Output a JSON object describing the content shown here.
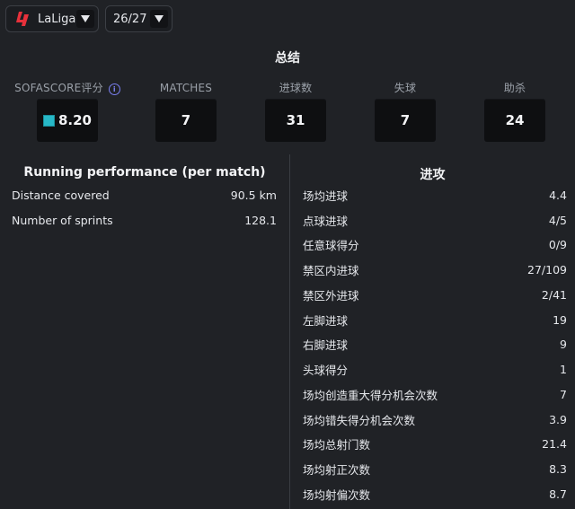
{
  "league_selector": {
    "label": "LaLiga",
    "logo_color": "#e8313b"
  },
  "season_selector": {
    "label": "26/27"
  },
  "summary": {
    "title": "总结",
    "rating": {
      "label": "SOFASCORE评分",
      "value": "8.20",
      "color": "#27b8c7"
    },
    "matches": {
      "label": "MATCHES",
      "value": "7"
    },
    "goals": {
      "label": "进球数",
      "value": "31"
    },
    "conceded": {
      "label": "失球",
      "value": "7"
    },
    "assists": {
      "label": "助杀",
      "value": "24"
    }
  },
  "running": {
    "title": "Running performance (per match)",
    "rows": [
      {
        "label": "Distance covered",
        "value": "90.5 km"
      },
      {
        "label": "Number of sprints",
        "value": "128.1"
      }
    ]
  },
  "attack": {
    "title": "进攻",
    "rows": [
      {
        "label": "场均进球",
        "value": "4.4"
      },
      {
        "label": "点球进球",
        "value": "4/5"
      },
      {
        "label": "任意球得分",
        "value": "0/9"
      },
      {
        "label": "禁区内进球",
        "value": "27/109"
      },
      {
        "label": "禁区外进球",
        "value": "2/41"
      },
      {
        "label": "左脚进球",
        "value": "19"
      },
      {
        "label": "右脚进球",
        "value": "9"
      },
      {
        "label": "头球得分",
        "value": "1"
      },
      {
        "label": "场均创造重大得分机会次数",
        "value": "7"
      },
      {
        "label": "场均错失得分机会次数",
        "value": "3.9"
      },
      {
        "label": "场均总射门数",
        "value": "21.4"
      },
      {
        "label": "场均射正次数",
        "value": "8.3"
      },
      {
        "label": "场均射偏次数",
        "value": "8.7"
      }
    ]
  }
}
